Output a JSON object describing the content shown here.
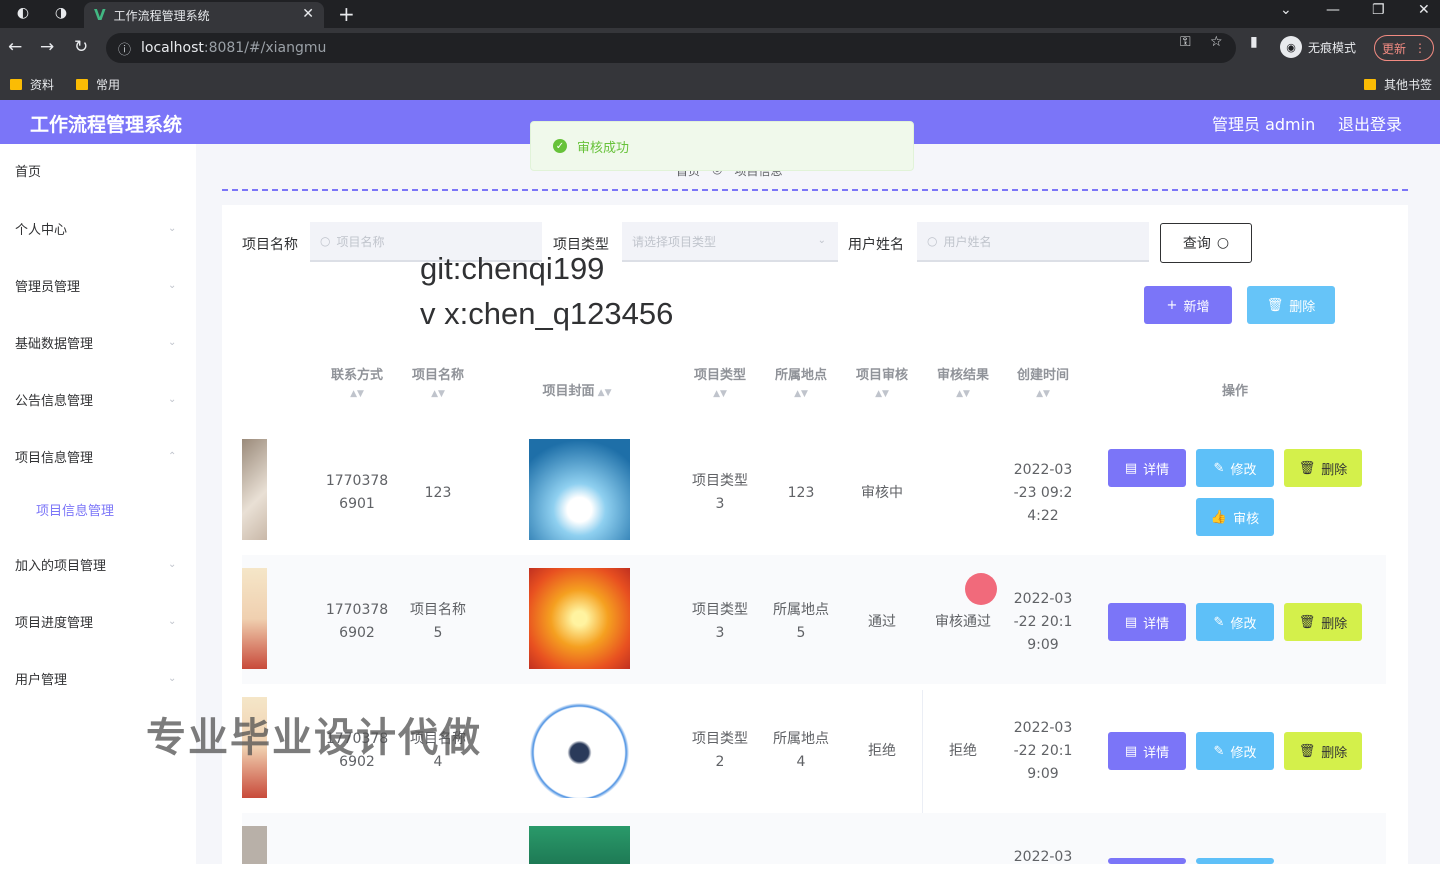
{
  "browser": {
    "tab_title": "工作流程管理系统",
    "url_host": "localhost",
    "url_path": ":8081/#/xiangmu",
    "incognito_label": "无痕模式",
    "update_label": "更新",
    "bookmarks": [
      "资料",
      "常用"
    ],
    "other_bookmarks": "其他书签"
  },
  "header": {
    "title": "工作流程管理系统",
    "admin": "管理员 admin",
    "logout": "退出登录"
  },
  "sidebar": {
    "items": [
      "首页",
      "个人中心",
      "管理员管理",
      "基础数据管理",
      "公告信息管理",
      "项目信息管理",
      "项目信息管理",
      "加入的项目管理",
      "项目进度管理",
      "用户管理"
    ]
  },
  "toast": {
    "message": "审核成功"
  },
  "breadcrumb": {
    "home": "首页",
    "current": "项目信息"
  },
  "search": {
    "name_label": "项目名称",
    "name_placeholder": "项目名称",
    "type_label": "项目类型",
    "type_placeholder": "请选择项目类型",
    "user_label": "用户姓名",
    "user_placeholder": "用户姓名",
    "query_label": "查询"
  },
  "actions": {
    "add": "新增",
    "delete": "删除"
  },
  "watermark": {
    "line1": "git:chenqi199",
    "line2": "v x:chen_q123456",
    "big": "专业毕业设计代做"
  },
  "table": {
    "headers": [
      "联系方式",
      "项目名称",
      "项目封面",
      "项目类型",
      "所属地点",
      "项目审核",
      "审核结果",
      "创建时间",
      "操作"
    ],
    "rows": [
      {
        "phone": [
          "1770378",
          "6901"
        ],
        "name": [
          "123"
        ],
        "type": [
          "项目类型",
          "3"
        ],
        "place": [
          "123"
        ],
        "audit": "审核中",
        "result": "",
        "time": [
          "2022-03",
          "-23 09:2",
          "4:22"
        ],
        "extra_button": "审核"
      },
      {
        "phone": [
          "1770378",
          "6902"
        ],
        "name": [
          "项目名称",
          "5"
        ],
        "type": [
          "项目类型",
          "3"
        ],
        "place": [
          "所属地点",
          "5"
        ],
        "audit": "通过",
        "result": "审核通过",
        "time": [
          "2022-03",
          "-22 20:1",
          "9:09"
        ]
      },
      {
        "phone": [
          "1770378",
          "6902"
        ],
        "name": [
          "项目名称",
          "4"
        ],
        "type": [
          "项目类型",
          "2"
        ],
        "place": [
          "所属地点",
          "4"
        ],
        "audit": "拒绝",
        "result": "拒绝",
        "time": [
          "2022-03",
          "-22 20:1",
          "9:09"
        ]
      },
      {
        "phone": [
          "",
          ""
        ],
        "name": [
          ""
        ],
        "type": [
          "",
          ""
        ],
        "place": [
          ""
        ],
        "audit": "",
        "result": "",
        "time": [
          "2022-03"
        ]
      }
    ],
    "row_buttons": {
      "detail": "详情",
      "edit": "修改",
      "delete": "删除"
    }
  },
  "colors": {
    "primary": "#7b75f8",
    "info": "#5ec0f8",
    "warning": "#d4f04b",
    "success": "#67c23a"
  }
}
